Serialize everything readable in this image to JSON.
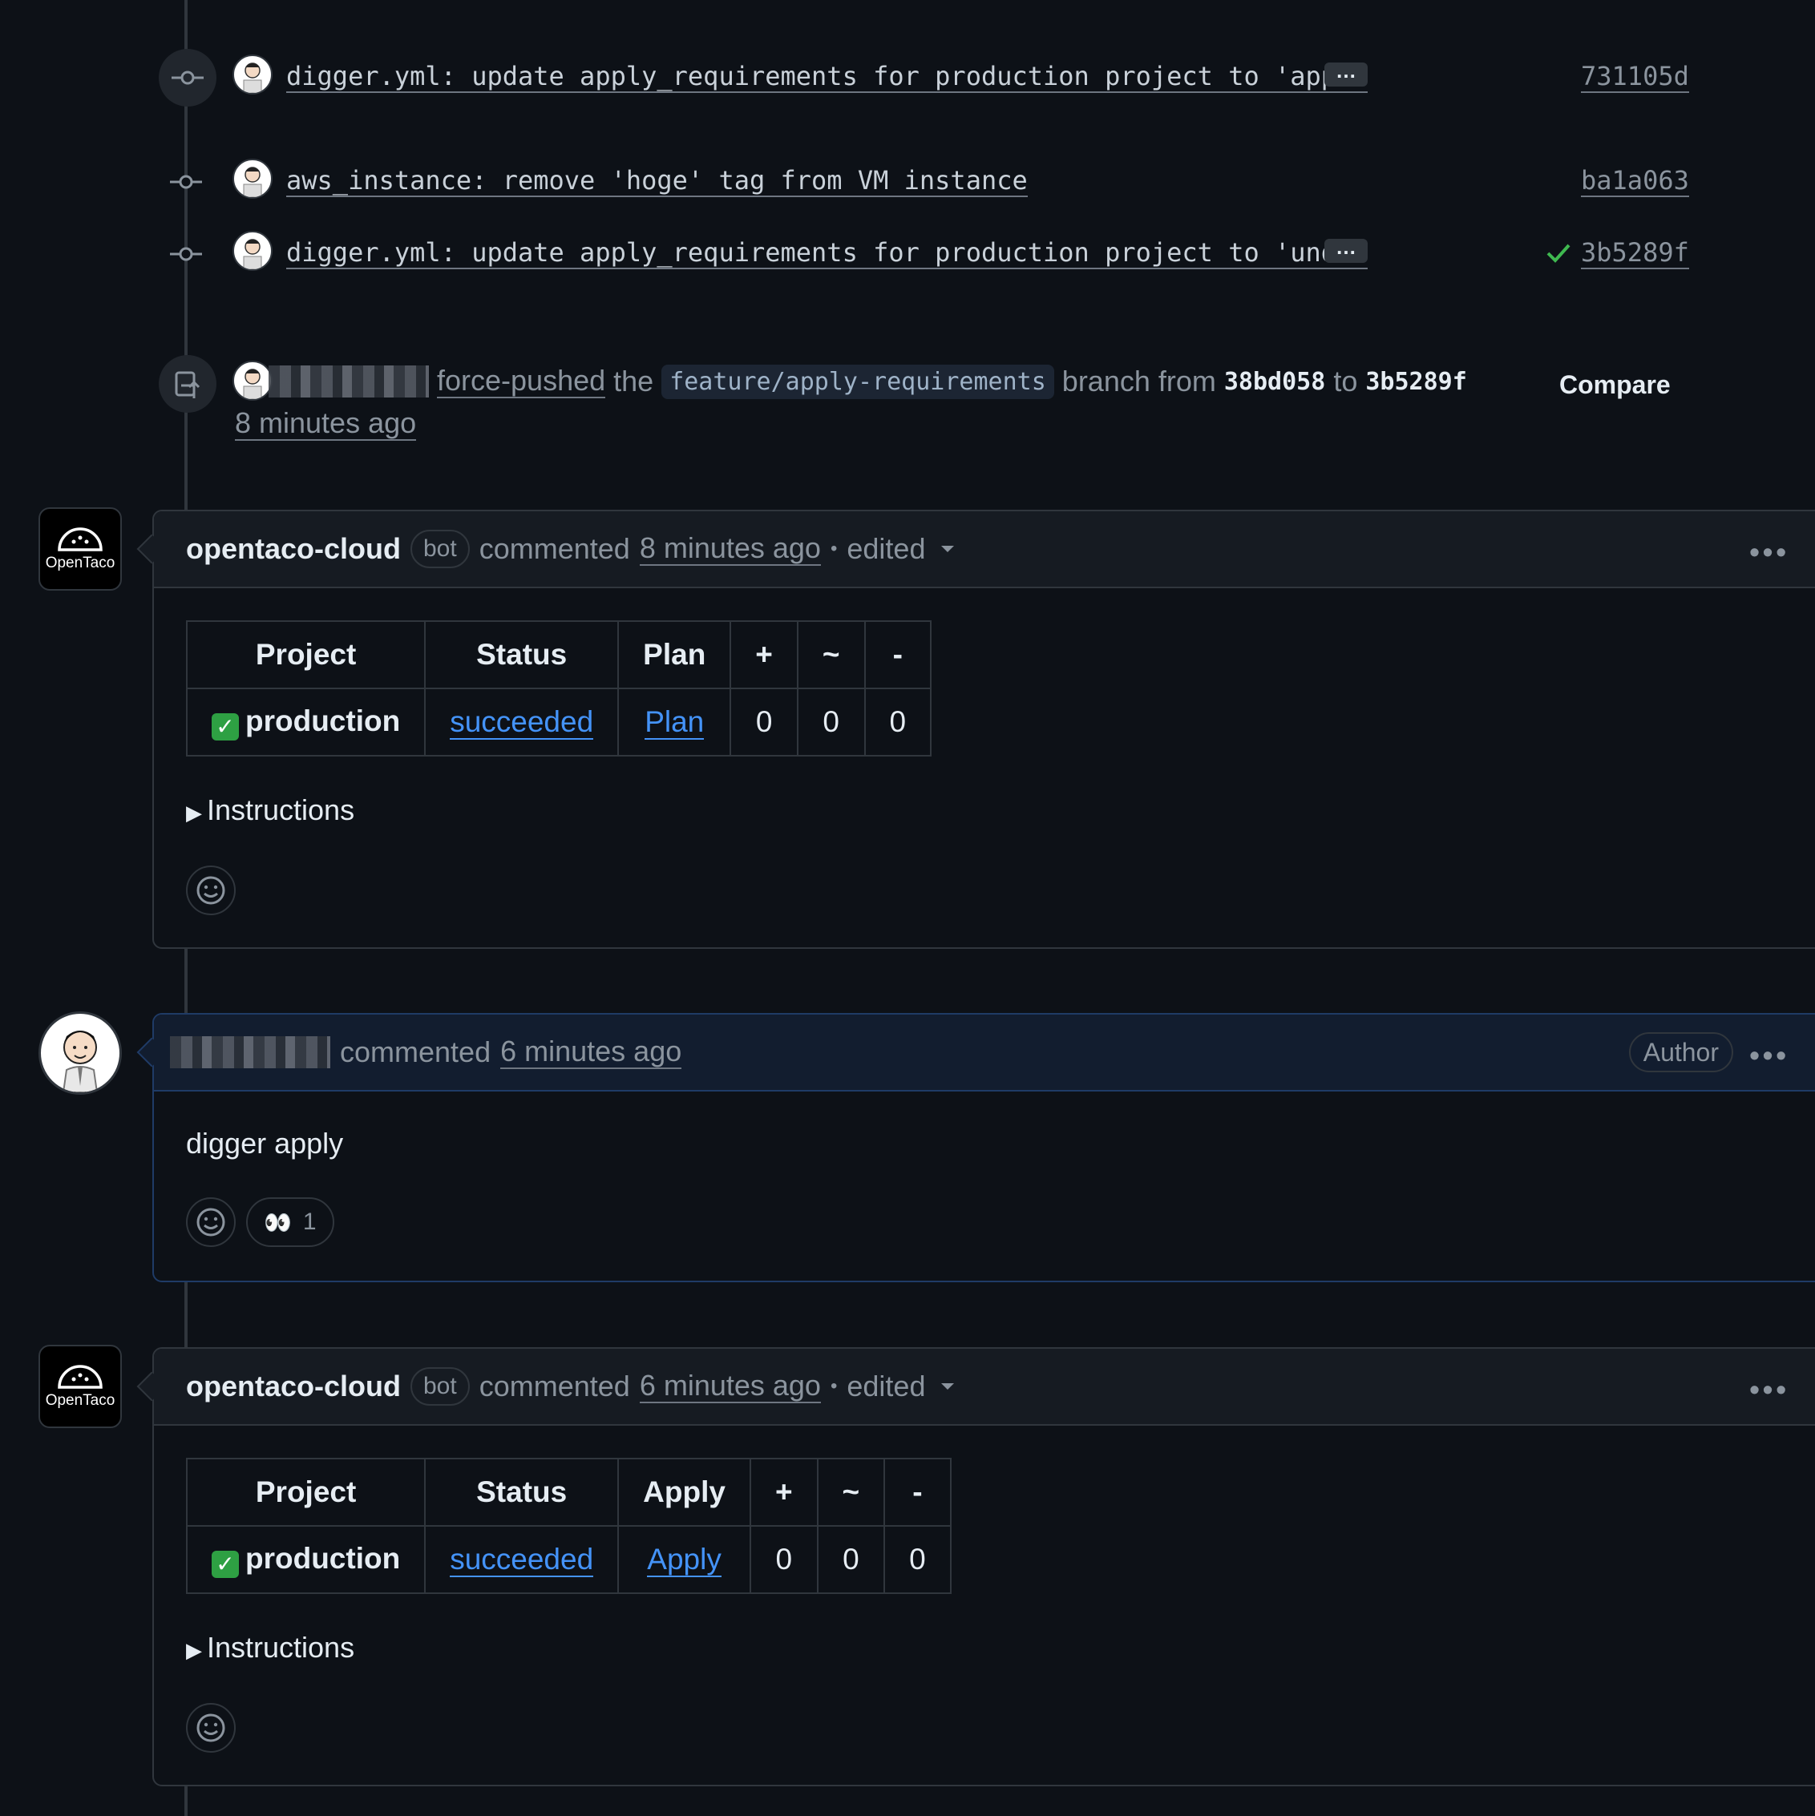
{
  "commits": [
    {
      "message": "digger.yml: update apply_requirements for production project to 'appr…",
      "sha": "731105d",
      "has_more": true,
      "verified": false
    },
    {
      "message": "aws_instance: remove 'hoge' tag from VM instance",
      "sha": "ba1a063",
      "has_more": false,
      "verified": false
    },
    {
      "message": "digger.yml: update apply_requirements for production project to 'undi…",
      "sha": "3b5289f",
      "has_more": true,
      "verified": true
    }
  ],
  "ellipsis": "…",
  "force_push": {
    "action": "force-pushed",
    "the": "the",
    "branch": "feature/apply-requirements",
    "branch_from": "branch from",
    "from_sha": "38bd058",
    "to": "to",
    "to_sha": "3b5289f",
    "time": "8 minutes ago",
    "compare": "Compare"
  },
  "comment1": {
    "author": "opentaco-cloud",
    "badge": "bot",
    "commented": "commented",
    "time": "8 minutes ago",
    "dot": "•",
    "edited": "edited",
    "avatar_label": "OpenTaco",
    "headers": [
      "Project",
      "Status",
      "Plan",
      "+",
      "~",
      "-"
    ],
    "row": {
      "project": "production",
      "status": "succeeded",
      "link": "Plan",
      "add": "0",
      "change": "0",
      "destroy": "0"
    },
    "instructions": "Instructions"
  },
  "comment2": {
    "commented": "commented",
    "time": "6 minutes ago",
    "author_badge": "Author",
    "body": "digger apply",
    "reaction_emoji": "👀",
    "reaction_count": "1"
  },
  "comment3": {
    "author": "opentaco-cloud",
    "badge": "bot",
    "commented": "commented",
    "time": "6 minutes ago",
    "dot": "•",
    "edited": "edited",
    "avatar_label": "OpenTaco",
    "headers": [
      "Project",
      "Status",
      "Apply",
      "+",
      "~",
      "-"
    ],
    "row": {
      "project": "production",
      "status": "succeeded",
      "link": "Apply",
      "add": "0",
      "change": "0",
      "destroy": "0"
    },
    "instructions": "Instructions"
  },
  "colors": {
    "background": "#0d1117",
    "link": "#4493f8",
    "success": "#2ea043",
    "border": "#30363d"
  }
}
